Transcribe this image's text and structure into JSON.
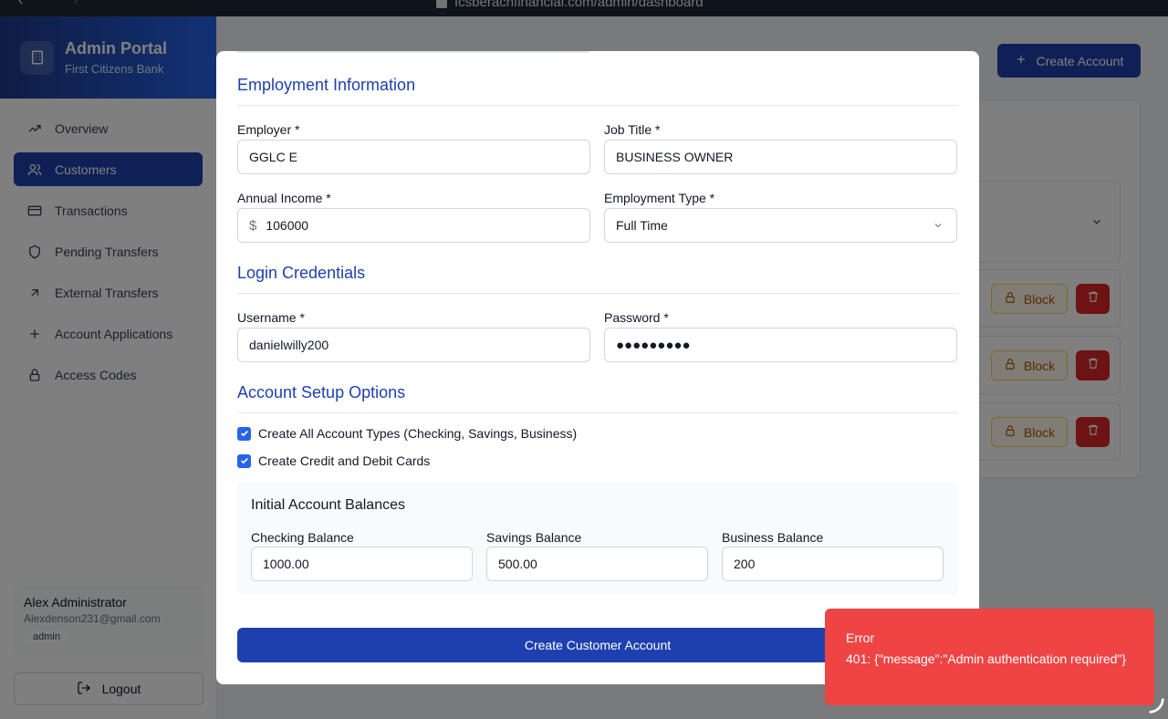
{
  "browser": {
    "url": "fcsberachfinancial.com/admin/dashboard"
  },
  "sidebar": {
    "brand_title": "Admin Portal",
    "brand_subtitle": "First Citizens Bank",
    "items": [
      {
        "label": "Overview",
        "icon": "trending-up-icon"
      },
      {
        "label": "Customers",
        "icon": "users-icon",
        "active": true
      },
      {
        "label": "Transactions",
        "icon": "credit-card-icon"
      },
      {
        "label": "Pending Transfers",
        "icon": "shield-icon"
      },
      {
        "label": "External Transfers",
        "icon": "arrow-up-right-icon"
      },
      {
        "label": "Account Applications",
        "icon": "plus-icon"
      },
      {
        "label": "Access Codes",
        "icon": "lock-icon"
      }
    ],
    "user": {
      "name": "Alex Administrator",
      "email": "Alexdenson231@gmail.com",
      "role": "admin"
    },
    "logout_label": "Logout"
  },
  "main": {
    "create_account_label": "Create Account",
    "block_label": "Block"
  },
  "modal": {
    "employment": {
      "title": "Employment Information",
      "employer_label": "Employer *",
      "employer_value": "GGLC E",
      "job_title_label": "Job Title *",
      "job_title_value": "BUSINESS OWNER",
      "income_label": "Annual Income *",
      "income_prefix": "$",
      "income_value": "106000",
      "type_label": "Employment Type *",
      "type_value": "Full Time"
    },
    "login": {
      "title": "Login Credentials",
      "username_label": "Username *",
      "username_value": "danielwilly200",
      "password_label": "Password *",
      "password_value": "●●●●●●●●●"
    },
    "setup": {
      "title": "Account Setup Options",
      "option_all_types": "Create All Account Types (Checking, Savings, Business)",
      "option_cards": "Create Credit and Debit Cards",
      "balances_title": "Initial Account Balances",
      "checking_label": "Checking Balance",
      "checking_value": "1000.00",
      "savings_label": "Savings Balance",
      "savings_value": "500.00",
      "business_label": "Business Balance",
      "business_value": "200"
    },
    "submit_label": "Create Customer Account"
  },
  "toast": {
    "title": "Error",
    "message": "401: {\"message\":\"Admin authentication required\"}"
  },
  "colors": {
    "primary": "#1e40af",
    "error": "#ef4444",
    "danger": "#dc2626"
  }
}
